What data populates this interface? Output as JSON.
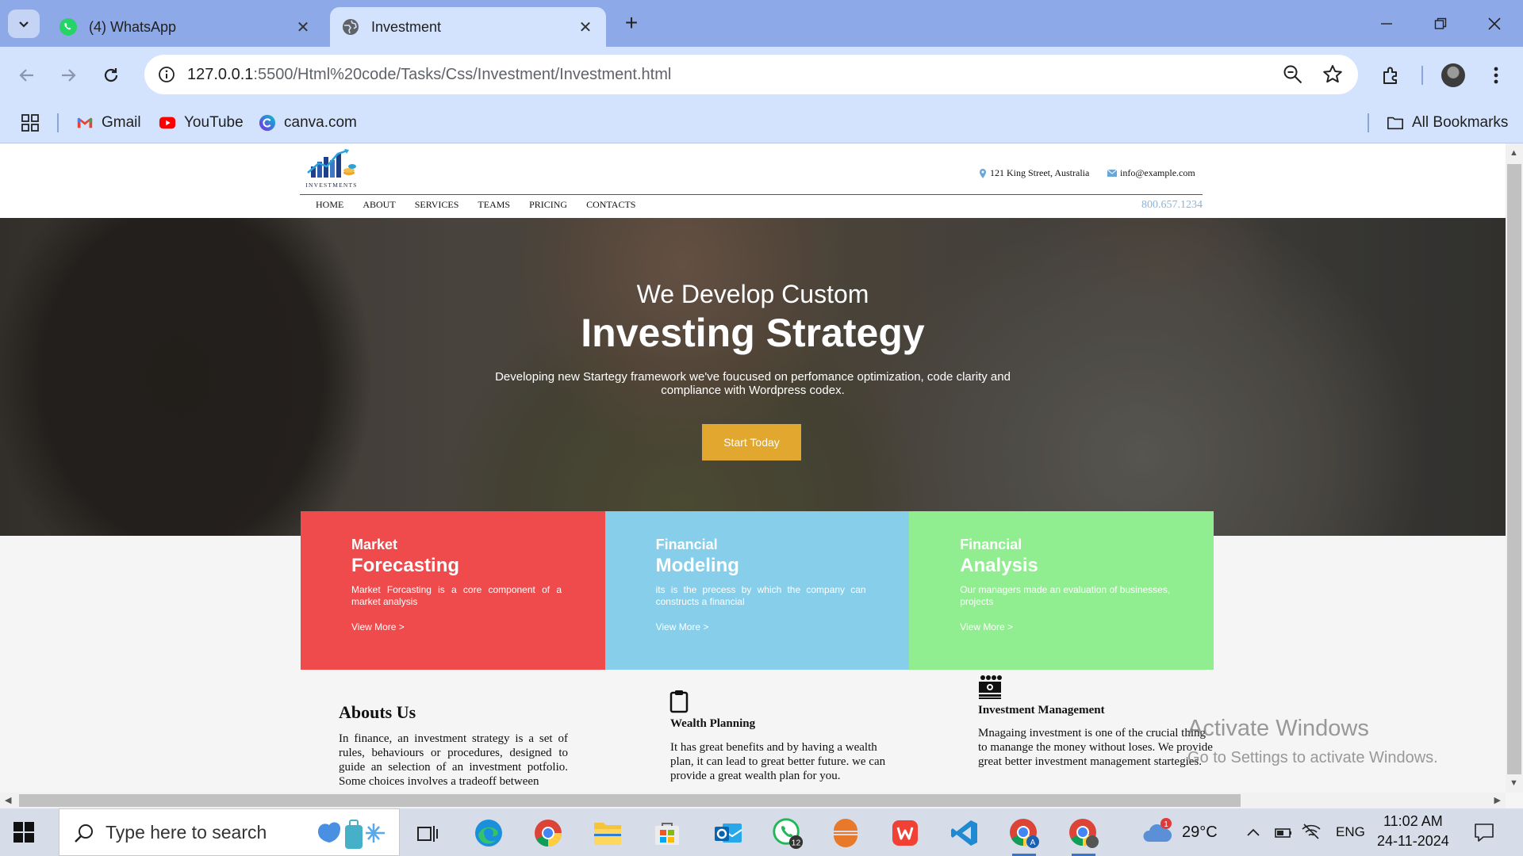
{
  "browser": {
    "tabs": [
      {
        "title": "(4) WhatsApp",
        "icon": "whatsapp-icon"
      },
      {
        "title": "Investment",
        "icon": "globe-icon"
      }
    ],
    "address_host": "127.0.0.1",
    "address_path": ":5500/Html%20code/Tasks/Css/Investment/Investment.html",
    "bookmarks": [
      "Gmail",
      "YouTube",
      "canva.com"
    ],
    "all_bookmarks": "All Bookmarks"
  },
  "site": {
    "logo_text": "INVESTMENTS",
    "address": "121 King Street, Australia",
    "email": "info@example.com",
    "phone": "800.657.1234",
    "nav": [
      "HOME",
      "ABOUT",
      "SERVICES",
      "TEAMS",
      "PRICING",
      "CONTACTS"
    ]
  },
  "hero": {
    "pre_title": "We Develop Custom",
    "title": "Investing Strategy",
    "text": "Developing new Startegy framework we've foucused on perfomance optimization, code clarity and compliance with Wordpress codex.",
    "button": "Start Today"
  },
  "cards": [
    {
      "small": "Market",
      "big": "Forecasting",
      "text": "Market Forcasting is a core component of a market analysis",
      "link": "View More >",
      "color": "#ef4b4c"
    },
    {
      "small": "Financial",
      "big": "Modeling",
      "text": "its is the precess by which the company can constructs a financial",
      "link": "View More >",
      "color": "#87ceeb"
    },
    {
      "small": "Financial",
      "big": "Analysis",
      "text": "Our managers made an evaluation of businesses, projects",
      "link": "View More >",
      "color": "#90ee90"
    }
  ],
  "about": {
    "title": "Abouts Us",
    "text": "In finance, an investment strategy is a set of rules, behaviours or procedures, designed to guide an selection of an investment potfolio. Some choices involves a tradeoff between"
  },
  "services": [
    {
      "title": "Wealth Planning",
      "text": "It has great benefits and by having a wealth plan, it can lead to great better future. we can provide a great wealth plan for you.",
      "icon": "clipboard-icon"
    },
    {
      "title": "Investment Management",
      "text": "Mnagaing investment is one of the crucial thing to manange the money without loses. We provide great better investment management startegies.",
      "icon": "money-stack-icon"
    }
  ],
  "watermark": {
    "line1": "Activate Windows",
    "line2": "Go to Settings to activate Windows."
  },
  "taskbar": {
    "search_placeholder": "Type here to search",
    "weather": "29°C",
    "weather_badge": "1",
    "lang": "ENG",
    "time": "11:02 AM",
    "date": "24-11-2024",
    "whatsapp_badge": "12"
  }
}
